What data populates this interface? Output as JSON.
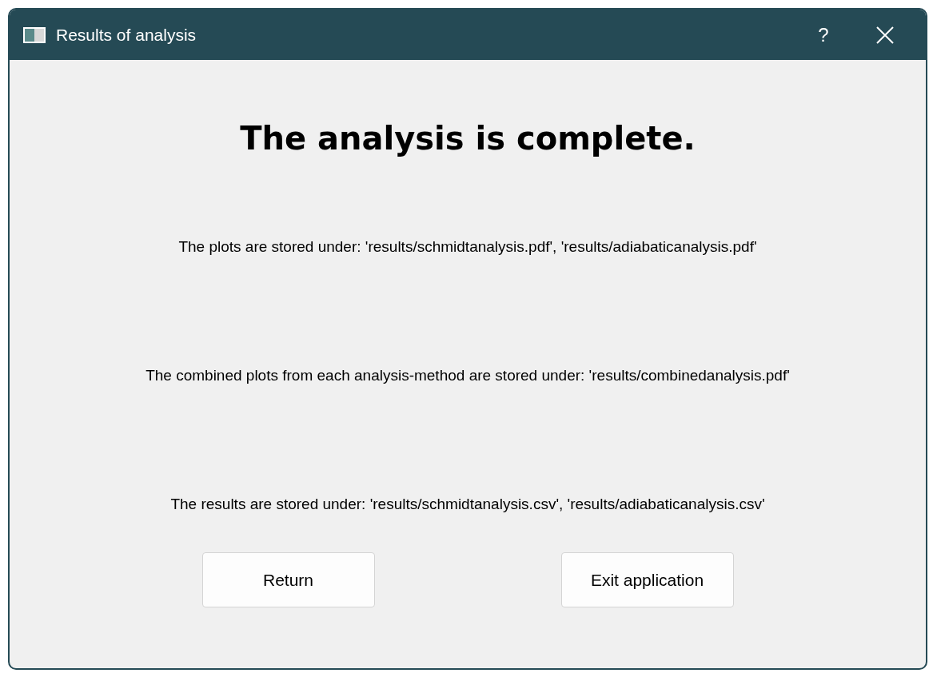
{
  "window": {
    "title": "Results of analysis",
    "help": "?"
  },
  "heading": "The analysis is complete.",
  "messages": [
    "The plots are stored under: 'results/schmidtanalysis.pdf', 'results/adiabaticanalysis.pdf'",
    "The combined plots from each analysis-method are stored under: 'results/combinedanalysis.pdf'",
    "The results are stored under: 'results/schmidtanalysis.csv', 'results/adiabaticanalysis.csv'"
  ],
  "buttons": [
    "Return",
    "Exit application"
  ]
}
